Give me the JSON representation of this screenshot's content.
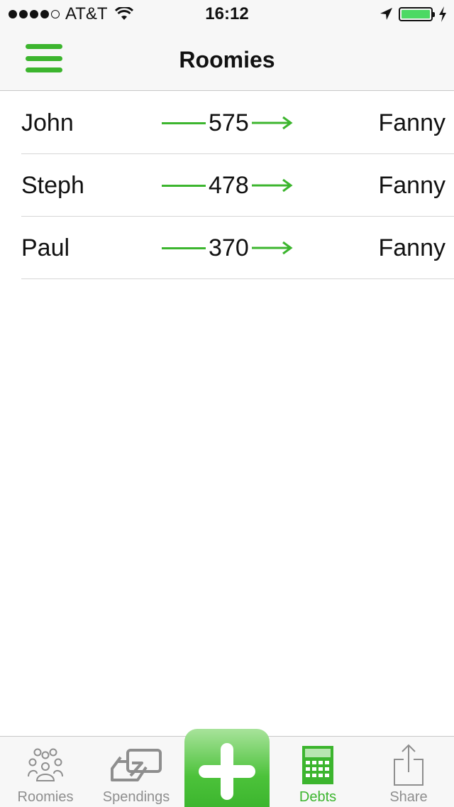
{
  "status_bar": {
    "carrier": "AT&T",
    "time": "16:12"
  },
  "nav": {
    "title": "Roomies"
  },
  "debts": [
    {
      "from": "John",
      "amount": "575",
      "to": "Fanny"
    },
    {
      "from": "Steph",
      "amount": "478",
      "to": "Fanny"
    },
    {
      "from": "Paul",
      "amount": "370",
      "to": "Fanny"
    }
  ],
  "tabs": {
    "roomies": "Roomies",
    "spendings": "Spendings",
    "debts": "Debts",
    "share": "Share"
  },
  "colors": {
    "accent": "#3cb52e",
    "inactive": "#8e8e8e"
  }
}
